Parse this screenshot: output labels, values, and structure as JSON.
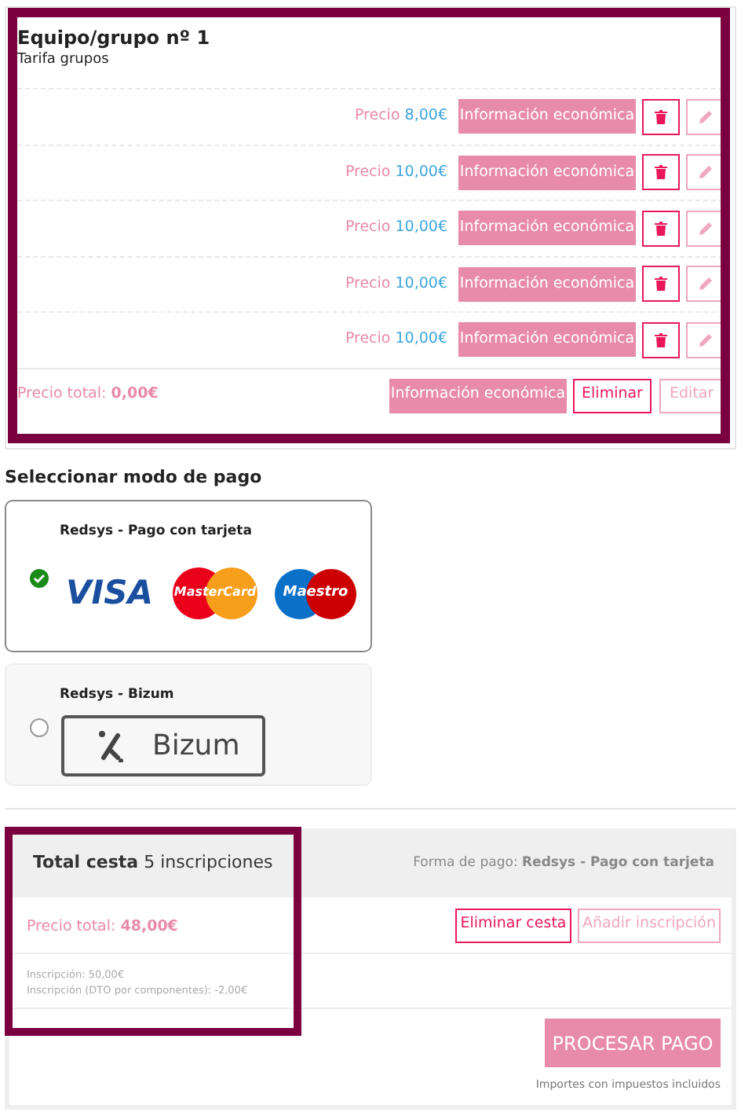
{
  "group": {
    "title": "Equipo/grupo nº 1",
    "subtitle": "Tarifa grupos",
    "rows": [
      {
        "price_label": "Precio",
        "price": "8,00€",
        "info_button": "Información económica"
      },
      {
        "price_label": "Precio",
        "price": "10,00€",
        "info_button": "Información económica"
      },
      {
        "price_label": "Precio",
        "price": "10,00€",
        "info_button": "Información económica"
      },
      {
        "price_label": "Precio",
        "price": "10,00€",
        "info_button": "Información económica"
      },
      {
        "price_label": "Precio",
        "price": "10,00€",
        "info_button": "Información económica"
      }
    ],
    "footer": {
      "total_label": "Precio total:",
      "total": "0,00€",
      "info_button": "Información económica",
      "delete_button": "Eliminar",
      "edit_button": "Editar"
    }
  },
  "payment": {
    "heading": "Seleccionar modo de pago",
    "methods": [
      {
        "name": "Redsys - Pago con tarjeta",
        "kind": "cards",
        "selected": true,
        "logo_texts": [
          "VISA",
          "MasterCard",
          "Maestro"
        ]
      },
      {
        "name": "Redsys - Bizum",
        "kind": "bizum",
        "selected": false,
        "logo_texts": [
          "Bizum"
        ]
      }
    ]
  },
  "basket": {
    "title": "Total cesta",
    "count": "5 inscripciones",
    "payment_label": "Forma de pago:",
    "payment_value": "Redsys - Pago con tarjeta",
    "total_label": "Precio total:",
    "total": "48,00€",
    "delete_button": "Eliminar cesta",
    "add_button": "Añadir inscripción",
    "breakdown": [
      "Inscripción: 50,00€",
      "Inscripción (DTO por componentes): -2,00€"
    ],
    "process_button": "PROCESAR PAGO",
    "note": "Importes con impuestos incluidos"
  }
}
